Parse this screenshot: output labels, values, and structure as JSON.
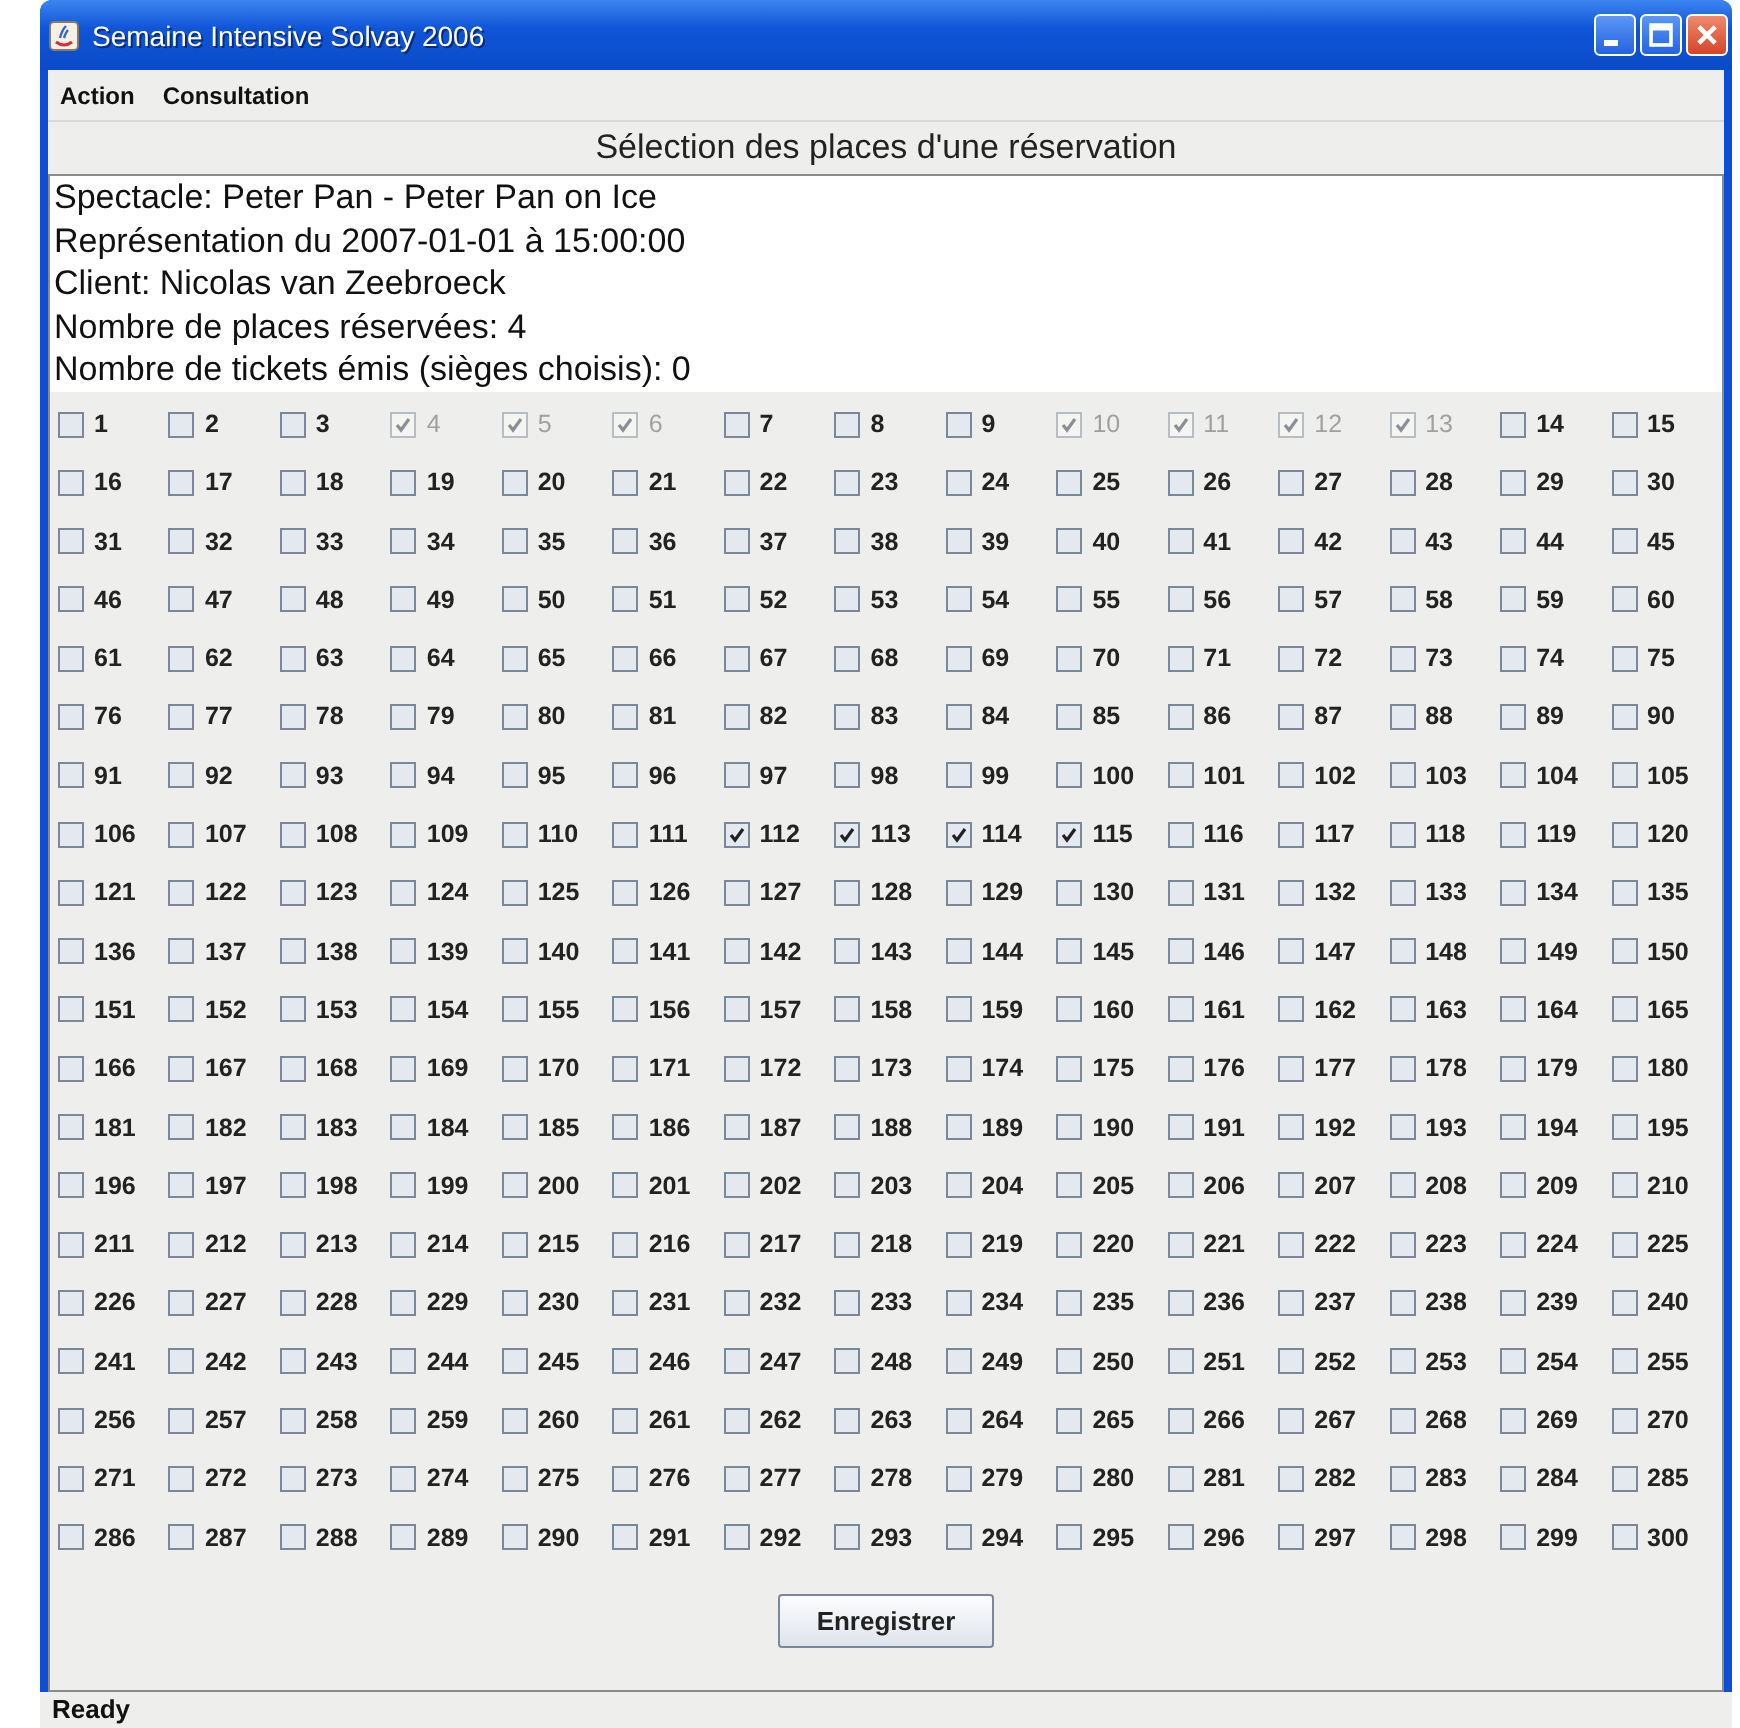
{
  "window": {
    "title": "Semaine Intensive Solvay 2006"
  },
  "menu": [
    "Action",
    "Consultation"
  ],
  "heading": "Sélection des places d'une réservation",
  "info": [
    "Spectacle: Peter Pan - Peter Pan on Ice",
    "Représentation du 2007-01-01 à 15:00:00",
    "Client: Nicolas van Zeebroeck",
    "Nombre de places réservées: 4",
    "Nombre de tickets émis (sièges choisis): 0"
  ],
  "seats": [
    {
      "label": "1",
      "checked": false,
      "disabled": false
    },
    {
      "label": "2",
      "checked": false,
      "disabled": false
    },
    {
      "label": "3",
      "checked": false,
      "disabled": false
    },
    {
      "label": "4",
      "checked": true,
      "disabled": true
    },
    {
      "label": "5",
      "checked": true,
      "disabled": true
    },
    {
      "label": "6",
      "checked": true,
      "disabled": true
    },
    {
      "label": "7",
      "checked": false,
      "disabled": false
    },
    {
      "label": "8",
      "checked": false,
      "disabled": false
    },
    {
      "label": "9",
      "checked": false,
      "disabled": false
    },
    {
      "label": "10",
      "checked": true,
      "disabled": true
    },
    {
      "label": "11",
      "checked": true,
      "disabled": true
    },
    {
      "label": "12",
      "checked": true,
      "disabled": true
    },
    {
      "label": "13",
      "checked": true,
      "disabled": true
    },
    {
      "label": "14",
      "checked": false,
      "disabled": false
    },
    {
      "label": "15",
      "checked": false,
      "disabled": false
    },
    {
      "label": "16",
      "checked": false,
      "disabled": false
    },
    {
      "label": "17",
      "checked": false,
      "disabled": false
    },
    {
      "label": "18",
      "checked": false,
      "disabled": false
    },
    {
      "label": "19",
      "checked": false,
      "disabled": false
    },
    {
      "label": "20",
      "checked": false,
      "disabled": false
    },
    {
      "label": "21",
      "checked": false,
      "disabled": false
    },
    {
      "label": "22",
      "checked": false,
      "disabled": false
    },
    {
      "label": "23",
      "checked": false,
      "disabled": false
    },
    {
      "label": "24",
      "checked": false,
      "disabled": false
    },
    {
      "label": "25",
      "checked": false,
      "disabled": false
    },
    {
      "label": "26",
      "checked": false,
      "disabled": false
    },
    {
      "label": "27",
      "checked": false,
      "disabled": false
    },
    {
      "label": "28",
      "checked": false,
      "disabled": false
    },
    {
      "label": "29",
      "checked": false,
      "disabled": false
    },
    {
      "label": "30",
      "checked": false,
      "disabled": false
    },
    {
      "label": "31",
      "checked": false,
      "disabled": false
    },
    {
      "label": "32",
      "checked": false,
      "disabled": false
    },
    {
      "label": "33",
      "checked": false,
      "disabled": false
    },
    {
      "label": "34",
      "checked": false,
      "disabled": false
    },
    {
      "label": "35",
      "checked": false,
      "disabled": false
    },
    {
      "label": "36",
      "checked": false,
      "disabled": false
    },
    {
      "label": "37",
      "checked": false,
      "disabled": false
    },
    {
      "label": "38",
      "checked": false,
      "disabled": false
    },
    {
      "label": "39",
      "checked": false,
      "disabled": false
    },
    {
      "label": "40",
      "checked": false,
      "disabled": false
    },
    {
      "label": "41",
      "checked": false,
      "disabled": false
    },
    {
      "label": "42",
      "checked": false,
      "disabled": false
    },
    {
      "label": "43",
      "checked": false,
      "disabled": false
    },
    {
      "label": "44",
      "checked": false,
      "disabled": false
    },
    {
      "label": "45",
      "checked": false,
      "disabled": false
    },
    {
      "label": "46",
      "checked": false,
      "disabled": false
    },
    {
      "label": "47",
      "checked": false,
      "disabled": false
    },
    {
      "label": "48",
      "checked": false,
      "disabled": false
    },
    {
      "label": "49",
      "checked": false,
      "disabled": false
    },
    {
      "label": "50",
      "checked": false,
      "disabled": false
    },
    {
      "label": "51",
      "checked": false,
      "disabled": false
    },
    {
      "label": "52",
      "checked": false,
      "disabled": false
    },
    {
      "label": "53",
      "checked": false,
      "disabled": false
    },
    {
      "label": "54",
      "checked": false,
      "disabled": false
    },
    {
      "label": "55",
      "checked": false,
      "disabled": false
    },
    {
      "label": "56",
      "checked": false,
      "disabled": false
    },
    {
      "label": "57",
      "checked": false,
      "disabled": false
    },
    {
      "label": "58",
      "checked": false,
      "disabled": false
    },
    {
      "label": "59",
      "checked": false,
      "disabled": false
    },
    {
      "label": "60",
      "checked": false,
      "disabled": false
    },
    {
      "label": "61",
      "checked": false,
      "disabled": false
    },
    {
      "label": "62",
      "checked": false,
      "disabled": false
    },
    {
      "label": "63",
      "checked": false,
      "disabled": false
    },
    {
      "label": "64",
      "checked": false,
      "disabled": false
    },
    {
      "label": "65",
      "checked": false,
      "disabled": false
    },
    {
      "label": "66",
      "checked": false,
      "disabled": false
    },
    {
      "label": "67",
      "checked": false,
      "disabled": false
    },
    {
      "label": "68",
      "checked": false,
      "disabled": false
    },
    {
      "label": "69",
      "checked": false,
      "disabled": false
    },
    {
      "label": "70",
      "checked": false,
      "disabled": false
    },
    {
      "label": "71",
      "checked": false,
      "disabled": false
    },
    {
      "label": "72",
      "checked": false,
      "disabled": false
    },
    {
      "label": "73",
      "checked": false,
      "disabled": false
    },
    {
      "label": "74",
      "checked": false,
      "disabled": false
    },
    {
      "label": "75",
      "checked": false,
      "disabled": false
    },
    {
      "label": "76",
      "checked": false,
      "disabled": false
    },
    {
      "label": "77",
      "checked": false,
      "disabled": false
    },
    {
      "label": "78",
      "checked": false,
      "disabled": false
    },
    {
      "label": "79",
      "checked": false,
      "disabled": false
    },
    {
      "label": "80",
      "checked": false,
      "disabled": false
    },
    {
      "label": "81",
      "checked": false,
      "disabled": false
    },
    {
      "label": "82",
      "checked": false,
      "disabled": false
    },
    {
      "label": "83",
      "checked": false,
      "disabled": false
    },
    {
      "label": "84",
      "checked": false,
      "disabled": false
    },
    {
      "label": "85",
      "checked": false,
      "disabled": false
    },
    {
      "label": "86",
      "checked": false,
      "disabled": false
    },
    {
      "label": "87",
      "checked": false,
      "disabled": false
    },
    {
      "label": "88",
      "checked": false,
      "disabled": false
    },
    {
      "label": "89",
      "checked": false,
      "disabled": false
    },
    {
      "label": "90",
      "checked": false,
      "disabled": false
    },
    {
      "label": "91",
      "checked": false,
      "disabled": false
    },
    {
      "label": "92",
      "checked": false,
      "disabled": false
    },
    {
      "label": "93",
      "checked": false,
      "disabled": false
    },
    {
      "label": "94",
      "checked": false,
      "disabled": false
    },
    {
      "label": "95",
      "checked": false,
      "disabled": false
    },
    {
      "label": "96",
      "checked": false,
      "disabled": false
    },
    {
      "label": "97",
      "checked": false,
      "disabled": false
    },
    {
      "label": "98",
      "checked": false,
      "disabled": false
    },
    {
      "label": "99",
      "checked": false,
      "disabled": false
    },
    {
      "label": "100",
      "checked": false,
      "disabled": false
    },
    {
      "label": "101",
      "checked": false,
      "disabled": false
    },
    {
      "label": "102",
      "checked": false,
      "disabled": false
    },
    {
      "label": "103",
      "checked": false,
      "disabled": false
    },
    {
      "label": "104",
      "checked": false,
      "disabled": false
    },
    {
      "label": "105",
      "checked": false,
      "disabled": false
    },
    {
      "label": "106",
      "checked": false,
      "disabled": false
    },
    {
      "label": "107",
      "checked": false,
      "disabled": false
    },
    {
      "label": "108",
      "checked": false,
      "disabled": false
    },
    {
      "label": "109",
      "checked": false,
      "disabled": false
    },
    {
      "label": "110",
      "checked": false,
      "disabled": false
    },
    {
      "label": "111",
      "checked": false,
      "disabled": false
    },
    {
      "label": "112",
      "checked": true,
      "disabled": false
    },
    {
      "label": "113",
      "checked": true,
      "disabled": false
    },
    {
      "label": "114",
      "checked": true,
      "disabled": false
    },
    {
      "label": "115",
      "checked": true,
      "disabled": false
    },
    {
      "label": "116",
      "checked": false,
      "disabled": false
    },
    {
      "label": "117",
      "checked": false,
      "disabled": false
    },
    {
      "label": "118",
      "checked": false,
      "disabled": false
    },
    {
      "label": "119",
      "checked": false,
      "disabled": false
    },
    {
      "label": "120",
      "checked": false,
      "disabled": false
    },
    {
      "label": "121",
      "checked": false,
      "disabled": false
    },
    {
      "label": "122",
      "checked": false,
      "disabled": false
    },
    {
      "label": "123",
      "checked": false,
      "disabled": false
    },
    {
      "label": "124",
      "checked": false,
      "disabled": false
    },
    {
      "label": "125",
      "checked": false,
      "disabled": false
    },
    {
      "label": "126",
      "checked": false,
      "disabled": false
    },
    {
      "label": "127",
      "checked": false,
      "disabled": false
    },
    {
      "label": "128",
      "checked": false,
      "disabled": false
    },
    {
      "label": "129",
      "checked": false,
      "disabled": false
    },
    {
      "label": "130",
      "checked": false,
      "disabled": false
    },
    {
      "label": "131",
      "checked": false,
      "disabled": false
    },
    {
      "label": "132",
      "checked": false,
      "disabled": false
    },
    {
      "label": "133",
      "checked": false,
      "disabled": false
    },
    {
      "label": "134",
      "checked": false,
      "disabled": false
    },
    {
      "label": "135",
      "checked": false,
      "disabled": false
    },
    {
      "label": "136",
      "checked": false,
      "disabled": false
    },
    {
      "label": "137",
      "checked": false,
      "disabled": false
    },
    {
      "label": "138",
      "checked": false,
      "disabled": false
    },
    {
      "label": "139",
      "checked": false,
      "disabled": false
    },
    {
      "label": "140",
      "checked": false,
      "disabled": false
    },
    {
      "label": "141",
      "checked": false,
      "disabled": false
    },
    {
      "label": "142",
      "checked": false,
      "disabled": false
    },
    {
      "label": "143",
      "checked": false,
      "disabled": false
    },
    {
      "label": "144",
      "checked": false,
      "disabled": false
    },
    {
      "label": "145",
      "checked": false,
      "disabled": false
    },
    {
      "label": "146",
      "checked": false,
      "disabled": false
    },
    {
      "label": "147",
      "checked": false,
      "disabled": false
    },
    {
      "label": "148",
      "checked": false,
      "disabled": false
    },
    {
      "label": "149",
      "checked": false,
      "disabled": false
    },
    {
      "label": "150",
      "checked": false,
      "disabled": false
    },
    {
      "label": "151",
      "checked": false,
      "disabled": false
    },
    {
      "label": "152",
      "checked": false,
      "disabled": false
    },
    {
      "label": "153",
      "checked": false,
      "disabled": false
    },
    {
      "label": "154",
      "checked": false,
      "disabled": false
    },
    {
      "label": "155",
      "checked": false,
      "disabled": false
    },
    {
      "label": "156",
      "checked": false,
      "disabled": false
    },
    {
      "label": "157",
      "checked": false,
      "disabled": false
    },
    {
      "label": "158",
      "checked": false,
      "disabled": false
    },
    {
      "label": "159",
      "checked": false,
      "disabled": false
    },
    {
      "label": "160",
      "checked": false,
      "disabled": false
    },
    {
      "label": "161",
      "checked": false,
      "disabled": false
    },
    {
      "label": "162",
      "checked": false,
      "disabled": false
    },
    {
      "label": "163",
      "checked": false,
      "disabled": false
    },
    {
      "label": "164",
      "checked": false,
      "disabled": false
    },
    {
      "label": "165",
      "checked": false,
      "disabled": false
    },
    {
      "label": "166",
      "checked": false,
      "disabled": false
    },
    {
      "label": "167",
      "checked": false,
      "disabled": false
    },
    {
      "label": "168",
      "checked": false,
      "disabled": false
    },
    {
      "label": "169",
      "checked": false,
      "disabled": false
    },
    {
      "label": "170",
      "checked": false,
      "disabled": false
    },
    {
      "label": "171",
      "checked": false,
      "disabled": false
    },
    {
      "label": "172",
      "checked": false,
      "disabled": false
    },
    {
      "label": "173",
      "checked": false,
      "disabled": false
    },
    {
      "label": "174",
      "checked": false,
      "disabled": false
    },
    {
      "label": "175",
      "checked": false,
      "disabled": false
    },
    {
      "label": "176",
      "checked": false,
      "disabled": false
    },
    {
      "label": "177",
      "checked": false,
      "disabled": false
    },
    {
      "label": "178",
      "checked": false,
      "disabled": false
    },
    {
      "label": "179",
      "checked": false,
      "disabled": false
    },
    {
      "label": "180",
      "checked": false,
      "disabled": false
    },
    {
      "label": "181",
      "checked": false,
      "disabled": false
    },
    {
      "label": "182",
      "checked": false,
      "disabled": false
    },
    {
      "label": "183",
      "checked": false,
      "disabled": false
    },
    {
      "label": "184",
      "checked": false,
      "disabled": false
    },
    {
      "label": "185",
      "checked": false,
      "disabled": false
    },
    {
      "label": "186",
      "checked": false,
      "disabled": false
    },
    {
      "label": "187",
      "checked": false,
      "disabled": false
    },
    {
      "label": "188",
      "checked": false,
      "disabled": false
    },
    {
      "label": "189",
      "checked": false,
      "disabled": false
    },
    {
      "label": "190",
      "checked": false,
      "disabled": false
    },
    {
      "label": "191",
      "checked": false,
      "disabled": false
    },
    {
      "label": "192",
      "checked": false,
      "disabled": false
    },
    {
      "label": "193",
      "checked": false,
      "disabled": false
    },
    {
      "label": "194",
      "checked": false,
      "disabled": false
    },
    {
      "label": "195",
      "checked": false,
      "disabled": false
    },
    {
      "label": "196",
      "checked": false,
      "disabled": false
    },
    {
      "label": "197",
      "checked": false,
      "disabled": false
    },
    {
      "label": "198",
      "checked": false,
      "disabled": false
    },
    {
      "label": "199",
      "checked": false,
      "disabled": false
    },
    {
      "label": "200",
      "checked": false,
      "disabled": false
    },
    {
      "label": "201",
      "checked": false,
      "disabled": false
    },
    {
      "label": "202",
      "checked": false,
      "disabled": false
    },
    {
      "label": "203",
      "checked": false,
      "disabled": false
    },
    {
      "label": "204",
      "checked": false,
      "disabled": false
    },
    {
      "label": "205",
      "checked": false,
      "disabled": false
    },
    {
      "label": "206",
      "checked": false,
      "disabled": false
    },
    {
      "label": "207",
      "checked": false,
      "disabled": false
    },
    {
      "label": "208",
      "checked": false,
      "disabled": false
    },
    {
      "label": "209",
      "checked": false,
      "disabled": false
    },
    {
      "label": "210",
      "checked": false,
      "disabled": false
    },
    {
      "label": "211",
      "checked": false,
      "disabled": false
    },
    {
      "label": "212",
      "checked": false,
      "disabled": false
    },
    {
      "label": "213",
      "checked": false,
      "disabled": false
    },
    {
      "label": "214",
      "checked": false,
      "disabled": false
    },
    {
      "label": "215",
      "checked": false,
      "disabled": false
    },
    {
      "label": "216",
      "checked": false,
      "disabled": false
    },
    {
      "label": "217",
      "checked": false,
      "disabled": false
    },
    {
      "label": "218",
      "checked": false,
      "disabled": false
    },
    {
      "label": "219",
      "checked": false,
      "disabled": false
    },
    {
      "label": "220",
      "checked": false,
      "disabled": false
    },
    {
      "label": "221",
      "checked": false,
      "disabled": false
    },
    {
      "label": "222",
      "checked": false,
      "disabled": false
    },
    {
      "label": "223",
      "checked": false,
      "disabled": false
    },
    {
      "label": "224",
      "checked": false,
      "disabled": false
    },
    {
      "label": "225",
      "checked": false,
      "disabled": false
    },
    {
      "label": "226",
      "checked": false,
      "disabled": false
    },
    {
      "label": "227",
      "checked": false,
      "disabled": false
    },
    {
      "label": "228",
      "checked": false,
      "disabled": false
    },
    {
      "label": "229",
      "checked": false,
      "disabled": false
    },
    {
      "label": "230",
      "checked": false,
      "disabled": false
    },
    {
      "label": "231",
      "checked": false,
      "disabled": false
    },
    {
      "label": "232",
      "checked": false,
      "disabled": false
    },
    {
      "label": "233",
      "checked": false,
      "disabled": false
    },
    {
      "label": "234",
      "checked": false,
      "disabled": false
    },
    {
      "label": "235",
      "checked": false,
      "disabled": false
    },
    {
      "label": "236",
      "checked": false,
      "disabled": false
    },
    {
      "label": "237",
      "checked": false,
      "disabled": false
    },
    {
      "label": "238",
      "checked": false,
      "disabled": false
    },
    {
      "label": "239",
      "checked": false,
      "disabled": false
    },
    {
      "label": "240",
      "checked": false,
      "disabled": false
    },
    {
      "label": "241",
      "checked": false,
      "disabled": false
    },
    {
      "label": "242",
      "checked": false,
      "disabled": false
    },
    {
      "label": "243",
      "checked": false,
      "disabled": false
    },
    {
      "label": "244",
      "checked": false,
      "disabled": false
    },
    {
      "label": "245",
      "checked": false,
      "disabled": false
    },
    {
      "label": "246",
      "checked": false,
      "disabled": false
    },
    {
      "label": "247",
      "checked": false,
      "disabled": false
    },
    {
      "label": "248",
      "checked": false,
      "disabled": false
    },
    {
      "label": "249",
      "checked": false,
      "disabled": false
    },
    {
      "label": "250",
      "checked": false,
      "disabled": false
    },
    {
      "label": "251",
      "checked": false,
      "disabled": false
    },
    {
      "label": "252",
      "checked": false,
      "disabled": false
    },
    {
      "label": "253",
      "checked": false,
      "disabled": false
    },
    {
      "label": "254",
      "checked": false,
      "disabled": false
    },
    {
      "label": "255",
      "checked": false,
      "disabled": false
    },
    {
      "label": "256",
      "checked": false,
      "disabled": false
    },
    {
      "label": "257",
      "checked": false,
      "disabled": false
    },
    {
      "label": "258",
      "checked": false,
      "disabled": false
    },
    {
      "label": "259",
      "checked": false,
      "disabled": false
    },
    {
      "label": "260",
      "checked": false,
      "disabled": false
    },
    {
      "label": "261",
      "checked": false,
      "disabled": false
    },
    {
      "label": "262",
      "checked": false,
      "disabled": false
    },
    {
      "label": "263",
      "checked": false,
      "disabled": false
    },
    {
      "label": "264",
      "checked": false,
      "disabled": false
    },
    {
      "label": "265",
      "checked": false,
      "disabled": false
    },
    {
      "label": "266",
      "checked": false,
      "disabled": false
    },
    {
      "label": "267",
      "checked": false,
      "disabled": false
    },
    {
      "label": "268",
      "checked": false,
      "disabled": false
    },
    {
      "label": "269",
      "checked": false,
      "disabled": false
    },
    {
      "label": "270",
      "checked": false,
      "disabled": false
    },
    {
      "label": "271",
      "checked": false,
      "disabled": false
    },
    {
      "label": "272",
      "checked": false,
      "disabled": false
    },
    {
      "label": "273",
      "checked": false,
      "disabled": false
    },
    {
      "label": "274",
      "checked": false,
      "disabled": false
    },
    {
      "label": "275",
      "checked": false,
      "disabled": false
    },
    {
      "label": "276",
      "checked": false,
      "disabled": false
    },
    {
      "label": "277",
      "checked": false,
      "disabled": false
    },
    {
      "label": "278",
      "checked": false,
      "disabled": false
    },
    {
      "label": "279",
      "checked": false,
      "disabled": false
    },
    {
      "label": "280",
      "checked": false,
      "disabled": false
    },
    {
      "label": "281",
      "checked": false,
      "disabled": false
    },
    {
      "label": "282",
      "checked": false,
      "disabled": false
    },
    {
      "label": "283",
      "checked": false,
      "disabled": false
    },
    {
      "label": "284",
      "checked": false,
      "disabled": false
    },
    {
      "label": "285",
      "checked": false,
      "disabled": false
    },
    {
      "label": "286",
      "checked": false,
      "disabled": false
    },
    {
      "label": "287",
      "checked": false,
      "disabled": false
    },
    {
      "label": "288",
      "checked": false,
      "disabled": false
    },
    {
      "label": "289",
      "checked": false,
      "disabled": false
    },
    {
      "label": "290",
      "checked": false,
      "disabled": false
    },
    {
      "label": "291",
      "checked": false,
      "disabled": false
    },
    {
      "label": "292",
      "checked": false,
      "disabled": false
    },
    {
      "label": "293",
      "checked": false,
      "disabled": false
    },
    {
      "label": "294",
      "checked": false,
      "disabled": false
    },
    {
      "label": "295",
      "checked": false,
      "disabled": false
    },
    {
      "label": "296",
      "checked": false,
      "disabled": false
    },
    {
      "label": "297",
      "checked": false,
      "disabled": false
    },
    {
      "label": "298",
      "checked": false,
      "disabled": false
    },
    {
      "label": "299",
      "checked": false,
      "disabled": false
    },
    {
      "label": "300",
      "checked": false,
      "disabled": false
    }
  ],
  "button": "Enregistrer",
  "status_bar": "Ready"
}
